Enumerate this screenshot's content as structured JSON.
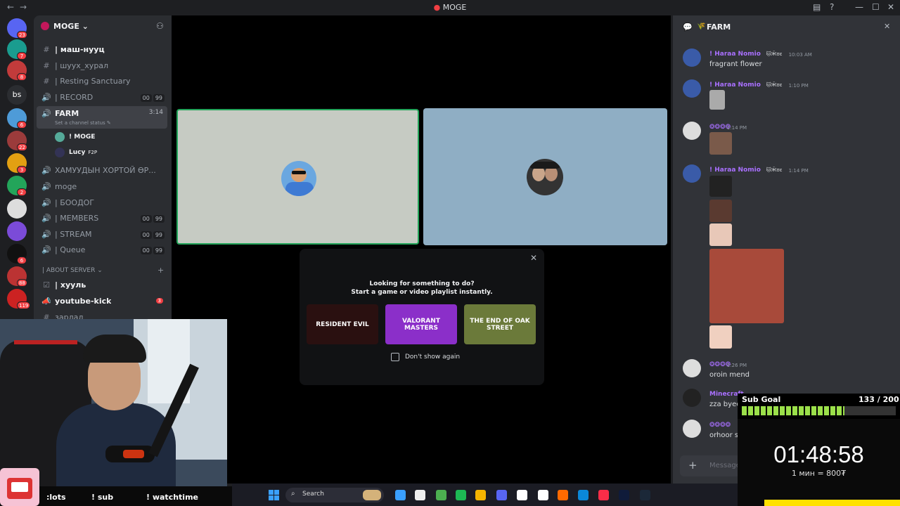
{
  "window": {
    "title": "MOGE",
    "back": "←",
    "forward": "→",
    "minimize": "—",
    "maximize": "☐",
    "close": "✕"
  },
  "colors": {
    "accent": "#5865f2",
    "green": "#23a55a",
    "red": "#f23f43",
    "purple": "#a970ff"
  },
  "guilds": [
    {
      "label": "",
      "badge": "23",
      "color": "#5865f2"
    },
    {
      "label": "",
      "badge": "7",
      "color": "#1a9c8f"
    },
    {
      "label": "",
      "badge": "8",
      "color": "#c23b3b"
    },
    {
      "label": "bs",
      "badge": "",
      "color": "#2b2d31"
    },
    {
      "label": "",
      "badge": "6",
      "color": "#4e9bd8"
    },
    {
      "label": "",
      "badge": "22",
      "color": "#9b3b3b"
    },
    {
      "label": "",
      "badge": "3",
      "color": "#e3a012"
    },
    {
      "label": "",
      "badge": "2",
      "color": "#23a55a"
    },
    {
      "label": "",
      "badge": "",
      "color": "#ddd"
    },
    {
      "label": "",
      "badge": "",
      "color": "#7b4bd8"
    },
    {
      "label": "",
      "badge": "6",
      "color": "#111"
    },
    {
      "label": "",
      "badge": "88",
      "color": "#b33"
    },
    {
      "label": "",
      "badge": "119",
      "color": "#c22"
    }
  ],
  "server": {
    "name": "MOGE ⌄"
  },
  "channels": [
    {
      "icon": "#",
      "name": "| маш-нууц",
      "bright": true
    },
    {
      "icon": "#",
      "name": "| шуух_хурал",
      "bright": false
    },
    {
      "icon": "#",
      "name": "| Resting Sanctuary",
      "bright": false
    },
    {
      "icon": "🔊",
      "name": "| RECORD",
      "bright": false,
      "p1": "00",
      "p2": "99"
    },
    {
      "icon": "🔊",
      "name": "FARM",
      "bright": true,
      "timer": "3:14",
      "status": "Set a channel status ✎"
    }
  ],
  "voice_users": [
    {
      "name": "! MOGE"
    },
    {
      "name": "Lucy",
      "tag": "F2P"
    }
  ],
  "channels2": [
    {
      "icon": "🔊",
      "name": "ХАМУУДЫН ХОРТОЙ ӨР..."
    },
    {
      "icon": "🔊",
      "name": "moge"
    },
    {
      "icon": "🔊",
      "name": "| БООДОГ"
    },
    {
      "icon": "🔊",
      "name": "| MEMBERS",
      "p1": "00",
      "p2": "99"
    },
    {
      "icon": "🔊",
      "name": "| STREAM",
      "p1": "00",
      "p2": "99"
    },
    {
      "icon": "🔊",
      "name": "| Queue",
      "p1": "00",
      "p2": "99"
    }
  ],
  "category": {
    "name": "| ABOUT SERVER ⌄",
    "add": "+"
  },
  "channels3": [
    {
      "icon": "☑",
      "name": "| хууль"
    },
    {
      "icon": "📣",
      "name": "youtube-kick",
      "badge": "3"
    },
    {
      "icon": "#",
      "name": "зарлал"
    }
  ],
  "popup": {
    "line1": "Looking for something to do?",
    "line2": "Start a game or video playlist instantly.",
    "cards": [
      {
        "label": "RESIDENT EVIL",
        "color": "#2a1010"
      },
      {
        "label": "VALORANT MASTERS",
        "color": "#8b2fc9"
      },
      {
        "label": "THE END OF OAK STREET",
        "color": "#6b7a3a"
      }
    ],
    "checkbox": "Don't show again",
    "close": "✕"
  },
  "chat": {
    "channel": "FARM",
    "close": "✕",
    "messages": [
      {
        "name": "! Haraa Nomio",
        "tag": "🐱Ӂʊɛ",
        "time": "10:03 AM",
        "text": "fragrant flower"
      },
      {
        "name": "! Haraa Nomio",
        "tag": "🐱Ӂʊɛ",
        "time": "1:10 PM",
        "text": ""
      },
      {
        "name": "❂❂❂❂",
        "tag": "",
        "time": "1:14 PM",
        "text": ""
      },
      {
        "name": "! Haraa Nomio",
        "tag": "🐱Ӂʊɛ",
        "time": "1:14 PM",
        "text": ""
      },
      {
        "name": "❂❂❂❂",
        "tag": "",
        "time": "1:26 PM",
        "text": "oroin mend"
      },
      {
        "name": "Minecraft",
        "tag": "",
        "time": "",
        "text": "zza byeee pptsaa"
      },
      {
        "name": "❂❂❂❂",
        "tag": "",
        "time": "",
        "text": "orhoor s"
      }
    ],
    "input_placeholder": "Message",
    "add": "+"
  },
  "stream_overlay": {
    "commands": [
      ":lots",
      "! sub",
      "! watchtime"
    ],
    "goal_label": "Sub Goal",
    "goal_value": "133 / 200",
    "goal_progress": 0.665,
    "timer": "01:48:58",
    "rate": "1 мин = 800₮"
  },
  "taskbar": {
    "search": "Search",
    "apps": [
      "#3aa0ff",
      "#eee",
      "#4caf50",
      "#1db954",
      "#f4b400",
      "#5865f2",
      "#fff",
      "#fff",
      "#ff6a00",
      "#0b88d8",
      "#fa2d48",
      "#0f1b3a",
      "#1b2838"
    ]
  }
}
